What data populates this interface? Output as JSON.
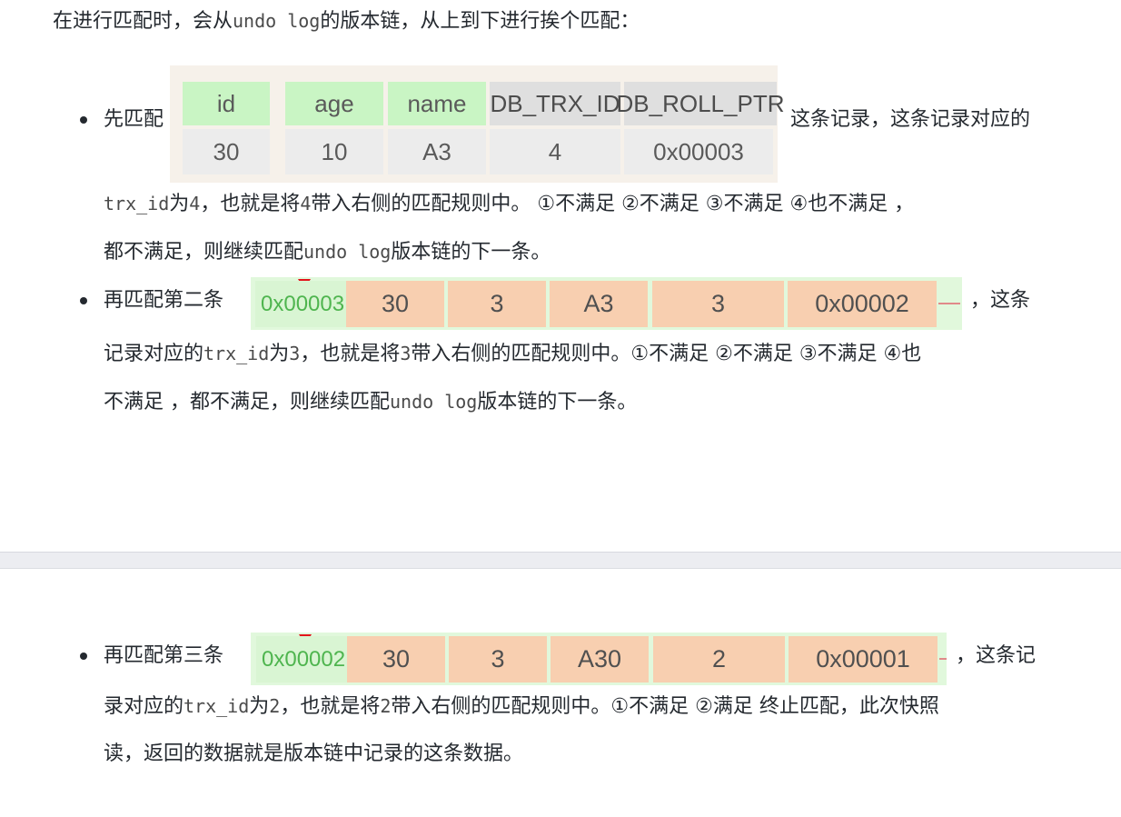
{
  "intro": {
    "pre": "在进行匹配时，会从",
    "code": "undo log",
    "post": "的版本链，从上到下进行挨个匹配："
  },
  "step1": {
    "lead": "先匹配",
    "after": "这条记录，这条记录对应的",
    "line2": {
      "code1": "trx_id",
      "t1": "为",
      "code2": "4",
      "t2": "，也就是将",
      "code3": "4",
      "t3": "带入右侧的匹配规则中。 ①不满足 ②不满足 ③不满足 ④也不满足 ，"
    },
    "line3": {
      "t1": "都不满足，则继续匹配",
      "code": "undo log",
      "t2": "版本链的下一条。"
    },
    "table": {
      "headers": [
        "id",
        "age",
        "name",
        "DB_TRX_ID",
        "DB_ROLL_PTR"
      ],
      "row": [
        "30",
        "10",
        "A3",
        "4",
        "0x00003"
      ]
    }
  },
  "step2": {
    "lead": "再匹配第二条",
    "after": "，这条",
    "row": {
      "ptr": "0x00003",
      "cells": [
        "30",
        "3",
        "A3",
        "3",
        "0x00002"
      ]
    },
    "line2": {
      "t1": "记录对应的",
      "code1": "trx_id",
      "t2": "为",
      "code2": "3",
      "t3": "，也就是将",
      "code3": "3",
      "t4": "带入右侧的匹配规则中。①不满足 ②不满足 ③不满足 ④也"
    },
    "line3": {
      "t1": "不满足 ，都不满足，则继续匹配",
      "code": "undo log",
      "t2": "版本链的下一条。"
    }
  },
  "step3": {
    "lead": "再匹配第三条",
    "after": "，这条记",
    "row": {
      "ptr": "0x00002",
      "cells": [
        "30",
        "3",
        "A30",
        "2",
        "0x00001"
      ]
    },
    "line2": {
      "t1": "录对应的",
      "code1": "trx_id",
      "t2": "为",
      "code2": "2",
      "t3": "，也就是将",
      "code3": "2",
      "t4": "带入右侧的匹配规则中。①不满足 ②满足 终止匹配，此次快照"
    },
    "line3": {
      "t1": "读，返回的数据就是版本链中记录的这条数据。"
    }
  },
  "colors": {
    "green_header": "#c9f5c4",
    "salmon_cell": "#f8cfb0",
    "pointer_red": "#e3141b",
    "divider": "#ecedf1"
  }
}
